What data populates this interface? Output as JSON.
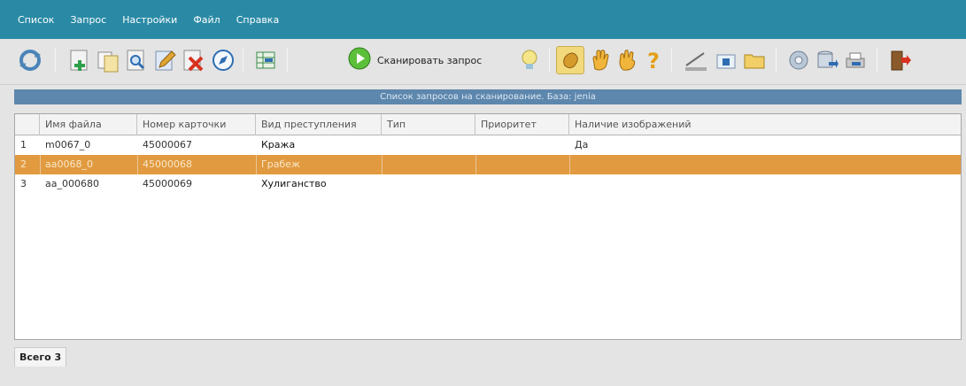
{
  "menu": [
    {
      "label": "Список"
    },
    {
      "label": "Запрос"
    },
    {
      "label": "Настройки"
    },
    {
      "label": "Файл"
    },
    {
      "label": "Справка"
    }
  ],
  "toolbar": {
    "scan_label": "Сканировать запрос",
    "accent": "#2a8aa5"
  },
  "panel": {
    "title": "Список запросов на сканирование. База: jenia"
  },
  "table": {
    "headers": [
      "",
      "Имя файла",
      "Номер карточки",
      "Вид преступления",
      "Тип",
      "Приоритет",
      "Наличие изображений"
    ],
    "rows": [
      {
        "n": "1",
        "file": "m0067_0",
        "card": "45000067",
        "crime": "Кража",
        "type": "",
        "priority": "",
        "images": "Да",
        "selected": false
      },
      {
        "n": "2",
        "file": "aa0068_0",
        "card": "45000068",
        "crime": "Грабеж",
        "type": "",
        "priority": "",
        "images": "",
        "selected": true
      },
      {
        "n": "3",
        "file": "aa_000680",
        "card": "45000069",
        "crime": "Хулиганство",
        "type": "",
        "priority": "",
        "images": "",
        "selected": false
      }
    ]
  },
  "status": {
    "total": "Всего 3"
  }
}
